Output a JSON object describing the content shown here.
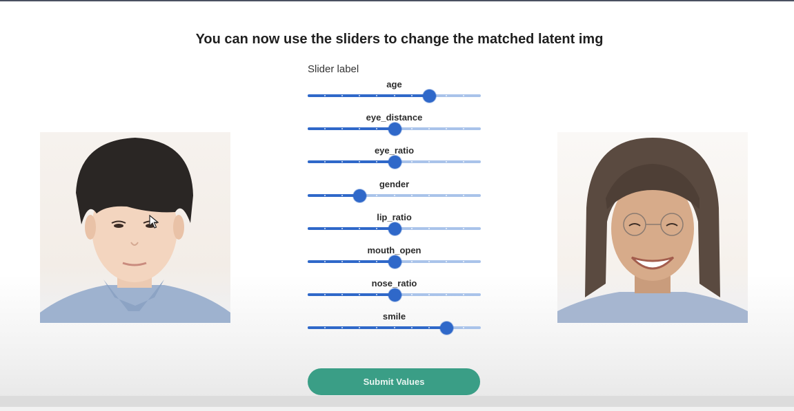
{
  "title": "You can now use the sliders to change the matched latent img",
  "slider_label": "Slider label",
  "sliders": [
    {
      "name": "age",
      "value": 0.7
    },
    {
      "name": "eye_distance",
      "value": 0.5
    },
    {
      "name": "eye_ratio",
      "value": 0.5
    },
    {
      "name": "gender",
      "value": 0.3
    },
    {
      "name": "lip_ratio",
      "value": 0.5
    },
    {
      "name": "mouth_open",
      "value": 0.5
    },
    {
      "name": "nose_ratio",
      "value": 0.5
    },
    {
      "name": "smile",
      "value": 0.8
    }
  ],
  "slider_steps": 10,
  "submit_label": "Submit Values",
  "colors": {
    "slider_fill": "#2f68c9",
    "slider_track": "#a9c3ea",
    "submit_button": "#3a9e86",
    "top_bar": "#4a5060"
  },
  "icons": {
    "cursor": "mouse-pointer-icon"
  }
}
